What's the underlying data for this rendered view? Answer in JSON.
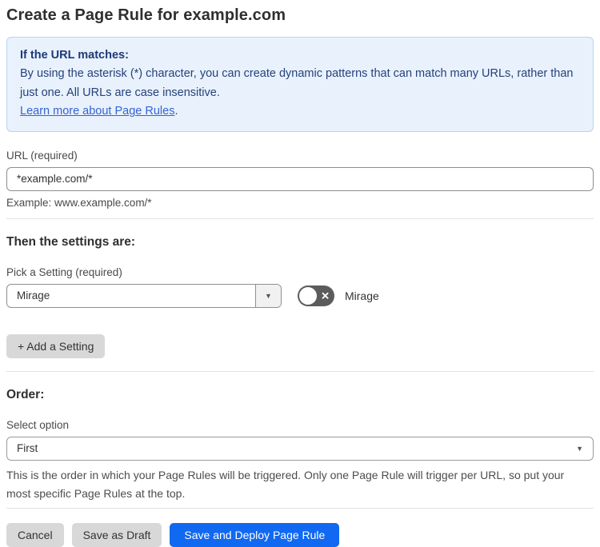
{
  "page": {
    "title": "Create a Page Rule for example.com"
  },
  "info_box": {
    "heading": "If the URL matches:",
    "body": "By using the asterisk (*) character, you can create dynamic patterns that can match many URLs, rather than just one. All URLs are case insensitive.",
    "link_text": "Learn more about Page Rules",
    "link_suffix": "."
  },
  "url_field": {
    "label": "URL (required)",
    "value": "*example.com/*",
    "helper": "Example: www.example.com/*"
  },
  "settings_section": {
    "heading": "Then the settings are:",
    "setting_label": "Pick a Setting (required)",
    "setting_value": "Mirage",
    "dropdown_arrow": "▼",
    "toggle_state": "off",
    "toggle_x_glyph": "✕",
    "toggle_label": "Mirage",
    "add_button_label": "+ Add a Setting"
  },
  "order_section": {
    "heading": "Order:",
    "label": "Select option",
    "value": "First",
    "dropdown_arrow": "▼",
    "helper": "This is the order in which your Page Rules will be triggered. Only one Page Rule will trigger per URL, so put your most specific Page Rules at the top."
  },
  "footer": {
    "cancel_label": "Cancel",
    "save_draft_label": "Save as Draft",
    "save_deploy_label": "Save and Deploy Page Rule"
  },
  "colors": {
    "primary_blue": "#1169f2",
    "info_background": "#e9f1fc",
    "info_border": "#b9d4f0",
    "info_text": "#24427c",
    "link_blue": "#3464d2",
    "toggle_off_background": "#5c5c5c",
    "gray_button_background": "#d8d8d8"
  }
}
